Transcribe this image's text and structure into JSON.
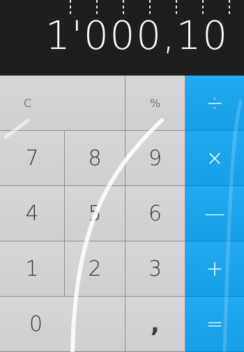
{
  "display": {
    "value": "1'000,10"
  },
  "keys": {
    "clear": "C",
    "percent": "%",
    "divide": "÷",
    "seven": "7",
    "eight": "8",
    "nine": "9",
    "multiply": "×",
    "four": "4",
    "five": "5",
    "six": "6",
    "minus": "—",
    "one": "1",
    "two": "2",
    "three": "3",
    "plus": "+",
    "zero": "0",
    "comma": ",",
    "equals": "="
  },
  "colors": {
    "display_bg": "#1e1e1e",
    "key_bg": "#d3d3d3",
    "operator_bg": "#1aa4ec"
  }
}
